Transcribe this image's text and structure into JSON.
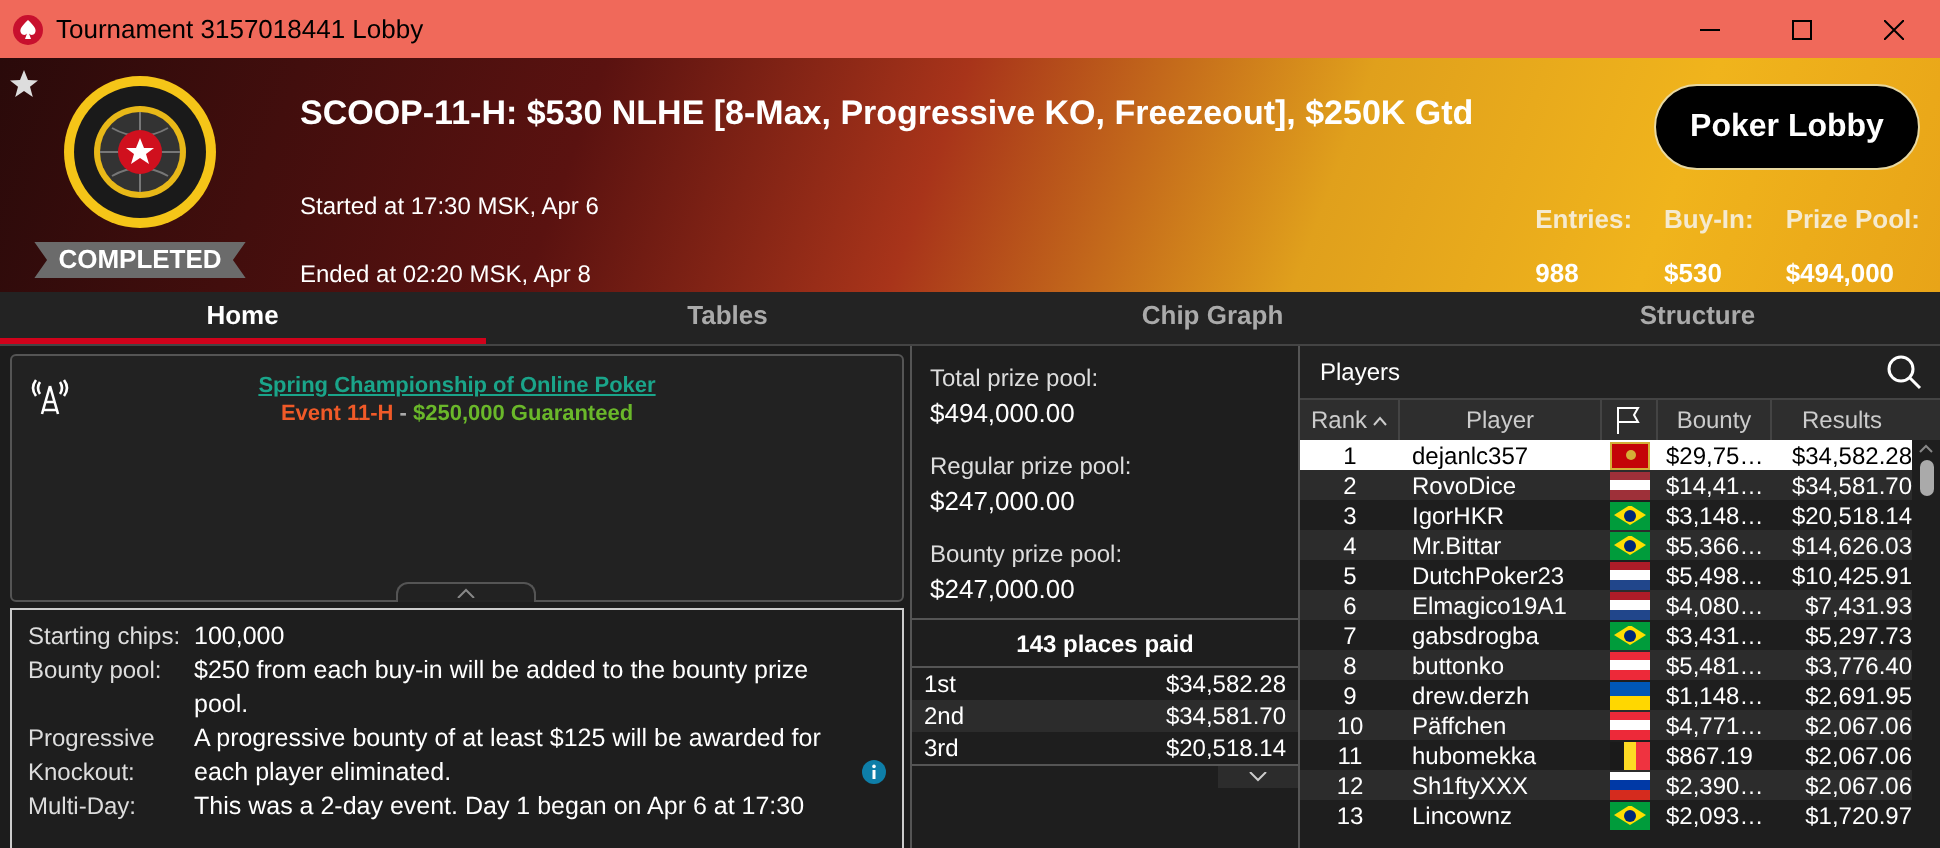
{
  "window": {
    "title": "Tournament 3157018441 Lobby"
  },
  "header": {
    "badge": "COMPLETED",
    "title": "SCOOP-11-H: $530 NLHE [8-Max, Progressive KO, Freezeout], $250K Gtd",
    "started": "Started at 17:30 MSK, Apr 6",
    "ended": "Ended at 02:20 MSK, Apr 8",
    "button": "Poker Lobby",
    "stats": [
      {
        "label": "Entries:",
        "value": "988"
      },
      {
        "label": "Buy-In:",
        "value": "$530"
      },
      {
        "label": "Prize Pool:",
        "value": "$494,000"
      }
    ]
  },
  "tabs": [
    {
      "label": "Home",
      "selected": true
    },
    {
      "label": "Tables",
      "selected": false
    },
    {
      "label": "Chip Graph",
      "selected": false
    },
    {
      "label": "Structure",
      "selected": false
    }
  ],
  "banner": {
    "link": "Spring Championship of Online Poker",
    "event": "Event 11-H",
    "separator": "-",
    "guarantee": "$250,000 Guaranteed"
  },
  "info": [
    {
      "label": "Starting chips:",
      "value": "100,000"
    },
    {
      "label": "Bounty pool:",
      "value": "$250 from each buy-in will be added to the bounty prize pool."
    },
    {
      "label": "Progressive Knockout:",
      "value": "A progressive bounty of at least $125 will be awarded for each player eliminated.",
      "info_icon": true
    },
    {
      "label": "Multi-Day:",
      "value": "This was a 2-day event. Day 1 began on Apr 6 at 17:30"
    }
  ],
  "pools": [
    {
      "label": "Total prize pool:",
      "value": "$494,000.00"
    },
    {
      "label": "Regular prize pool:",
      "value": "$247,000.00"
    },
    {
      "label": "Bounty prize pool:",
      "value": "$247,000.00"
    }
  ],
  "payouts": {
    "title": "143 places paid",
    "rows": [
      {
        "place": "1st",
        "amount": "$34,582.28"
      },
      {
        "place": "2nd",
        "amount": "$34,581.70"
      },
      {
        "place": "3rd",
        "amount": "$20,518.14"
      }
    ]
  },
  "players": {
    "title": "Players",
    "columns": [
      "Rank",
      "Player",
      "Bounty",
      "Results"
    ],
    "rows": [
      {
        "rank": "1",
        "name": "dejanlc357",
        "flag": {
          "kind": "emblem",
          "parts": [
            {
              "color": "#c40308"
            },
            {
              "color": "#d4af37"
            }
          ]
        },
        "bounty": "$29,75…",
        "result": "$34,582.28",
        "selected": true
      },
      {
        "rank": "2",
        "name": "RovoDice",
        "flag": {
          "kind": "stripes",
          "parts": [
            {
              "color": "#9e3039"
            },
            {
              "color": "#ffffff"
            },
            {
              "color": "#9e3039"
            }
          ]
        },
        "bounty": "$14,41…",
        "result": "$34,581.70",
        "selected": false
      },
      {
        "rank": "3",
        "name": "IgorHKR",
        "flag": {
          "kind": "diamond",
          "parts": [
            {
              "color": "#009c3b"
            },
            {
              "color": "#ffdf00"
            },
            {
              "color": "#002776"
            }
          ]
        },
        "bounty": "$3,148…",
        "result": "$20,518.14",
        "selected": false
      },
      {
        "rank": "4",
        "name": "Mr.Bittar",
        "flag": {
          "kind": "diamond",
          "parts": [
            {
              "color": "#009c3b"
            },
            {
              "color": "#ffdf00"
            },
            {
              "color": "#002776"
            }
          ]
        },
        "bounty": "$5,366…",
        "result": "$14,626.03",
        "selected": false
      },
      {
        "rank": "5",
        "name": "DutchPoker23",
        "flag": {
          "kind": "stripes",
          "parts": [
            {
              "color": "#ae1c28"
            },
            {
              "color": "#ffffff"
            },
            {
              "color": "#21468b"
            }
          ]
        },
        "bounty": "$5,498…",
        "result": "$10,425.91",
        "selected": false
      },
      {
        "rank": "6",
        "name": "Elmagico19A1",
        "flag": {
          "kind": "stripes",
          "parts": [
            {
              "color": "#ae1c28"
            },
            {
              "color": "#ffffff"
            },
            {
              "color": "#21468b"
            }
          ]
        },
        "bounty": "$4,080…",
        "result": "$7,431.93",
        "selected": false
      },
      {
        "rank": "7",
        "name": "gabsdrogba",
        "flag": {
          "kind": "diamond",
          "parts": [
            {
              "color": "#009c3b"
            },
            {
              "color": "#ffdf00"
            },
            {
              "color": "#002776"
            }
          ]
        },
        "bounty": "$3,431…",
        "result": "$5,297.73",
        "selected": false
      },
      {
        "rank": "8",
        "name": "buttonko",
        "flag": {
          "kind": "stripes",
          "parts": [
            {
              "color": "#ed2939"
            },
            {
              "color": "#ffffff"
            },
            {
              "color": "#ed2939"
            }
          ]
        },
        "bounty": "$5,481…",
        "result": "$3,776.40",
        "selected": false
      },
      {
        "rank": "9",
        "name": "drew.derzh",
        "flag": {
          "kind": "stripes",
          "parts": [
            {
              "color": "#0057b7"
            },
            {
              "color": "#ffd700"
            }
          ]
        },
        "bounty": "$1,148…",
        "result": "$2,691.95",
        "selected": false
      },
      {
        "rank": "10",
        "name": "Päffchen",
        "flag": {
          "kind": "stripes",
          "parts": [
            {
              "color": "#ed2939"
            },
            {
              "color": "#ffffff"
            },
            {
              "color": "#ed2939"
            }
          ]
        },
        "bounty": "$4,771…",
        "result": "$2,067.06",
        "selected": false
      },
      {
        "rank": "11",
        "name": "hubomekka",
        "flag": {
          "kind": "bars",
          "parts": [
            {
              "color": "#1a1a1a"
            },
            {
              "color": "#fdda24"
            },
            {
              "color": "#ef3340"
            }
          ]
        },
        "bounty": "$867.19",
        "result": "$2,067.06",
        "selected": false
      },
      {
        "rank": "12",
        "name": "Sh1ftyXXX",
        "flag": {
          "kind": "stripes",
          "parts": [
            {
              "color": "#ffffff"
            },
            {
              "color": "#0039a6"
            },
            {
              "color": "#d52b1e"
            }
          ]
        },
        "bounty": "$2,390…",
        "result": "$2,067.06",
        "selected": false
      },
      {
        "rank": "13",
        "name": "Lincownz",
        "flag": {
          "kind": "diamond",
          "parts": [
            {
              "color": "#009c3b"
            },
            {
              "color": "#ffdf00"
            },
            {
              "color": "#002776"
            }
          ]
        },
        "bounty": "$2,093…",
        "result": "$1,720.97",
        "selected": false
      }
    ]
  }
}
